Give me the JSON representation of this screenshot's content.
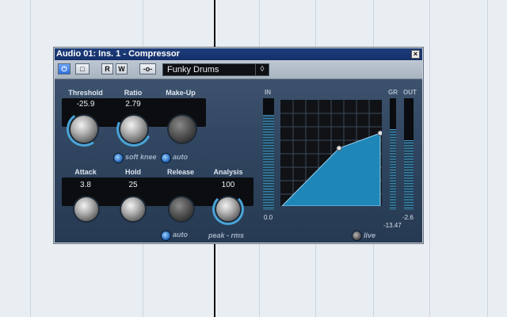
{
  "window": {
    "title": "Audio 01: Ins. 1 - Compressor",
    "close_glyph": "×"
  },
  "toolbar": {
    "power_glyph": "⏻",
    "bypass_glyph": "□",
    "read_label": "R",
    "write_label": "W",
    "routing_glyph": "-o-",
    "preset_name": "Funky Drums",
    "preset_menu_glyph": "◊"
  },
  "compressor": {
    "threshold": {
      "label": "Threshold",
      "value": "-25.9"
    },
    "ratio": {
      "label": "Ratio",
      "value": "2.79"
    },
    "makeup": {
      "label": "Make-Up"
    },
    "soft_knee": {
      "label": "soft knee",
      "active": true
    },
    "makeup_auto": {
      "label": "auto",
      "active": true
    },
    "attack": {
      "label": "Attack",
      "value": "3.8"
    },
    "hold": {
      "label": "Hold",
      "value": "25"
    },
    "release": {
      "label": "Release"
    },
    "analysis": {
      "label": "Analysis",
      "value": "100"
    },
    "release_auto": {
      "label": "auto",
      "active": true
    },
    "analysis_mode": {
      "label": "peak - rms"
    }
  },
  "meters": {
    "in_label": "IN",
    "gr_label": "GR",
    "out_label": "OUT",
    "in_value": "0.0",
    "out_value": "-2.6",
    "gr_value": "-13.47",
    "in_level": 0.85,
    "gr_level": 0.72,
    "out_level": 0.62
  },
  "live": {
    "label": "live",
    "active": false
  },
  "colors": {
    "accent": "#4aa4d6",
    "title_bar": "#1d3c7a",
    "panel": "#2f445e",
    "curve_fill": "#1f86b8"
  }
}
